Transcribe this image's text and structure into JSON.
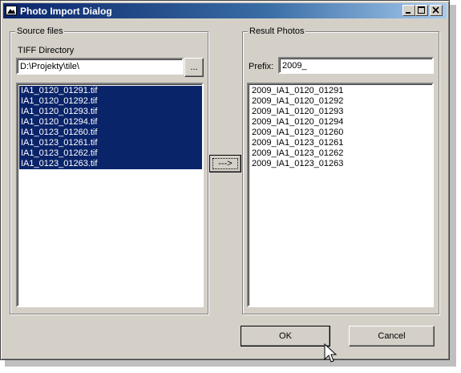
{
  "window": {
    "title": "Photo Import Dialog",
    "controls": [
      "minimize-icon",
      "maximize-icon",
      "close-icon"
    ]
  },
  "source": {
    "group_label": "Source files",
    "dir_label": "TIFF Directory",
    "dir_value": "D:\\Projekty\\tile\\",
    "browse_label": "...",
    "files": [
      "IA1_0120_01291.tif",
      "IA1_0120_01292.tif",
      "IA1_0120_01293.tif",
      "IA1_0120_01294.tif",
      "IA1_0123_01260.tif",
      "IA1_0123_01261.tif",
      "IA1_0123_01262.tif",
      "IA1_0123_01263.tif"
    ]
  },
  "transfer_label": "--->",
  "result": {
    "group_label": "Result Photos",
    "prefix_label": "Prefix:",
    "prefix_value": "2009_",
    "photos": [
      "2009_IA1_0120_01291",
      "2009_IA1_0120_01292",
      "2009_IA1_0120_01293",
      "2009_IA1_0120_01294",
      "2009_IA1_0123_01260",
      "2009_IA1_0123_01261",
      "2009_IA1_0123_01262",
      "2009_IA1_0123_01263"
    ]
  },
  "ok_label": "OK",
  "cancel_label": "Cancel",
  "colors": {
    "title_start": "#0a246a",
    "title_end": "#a6caf0",
    "face": "#d4d0c8",
    "selection": "#0a246a"
  }
}
